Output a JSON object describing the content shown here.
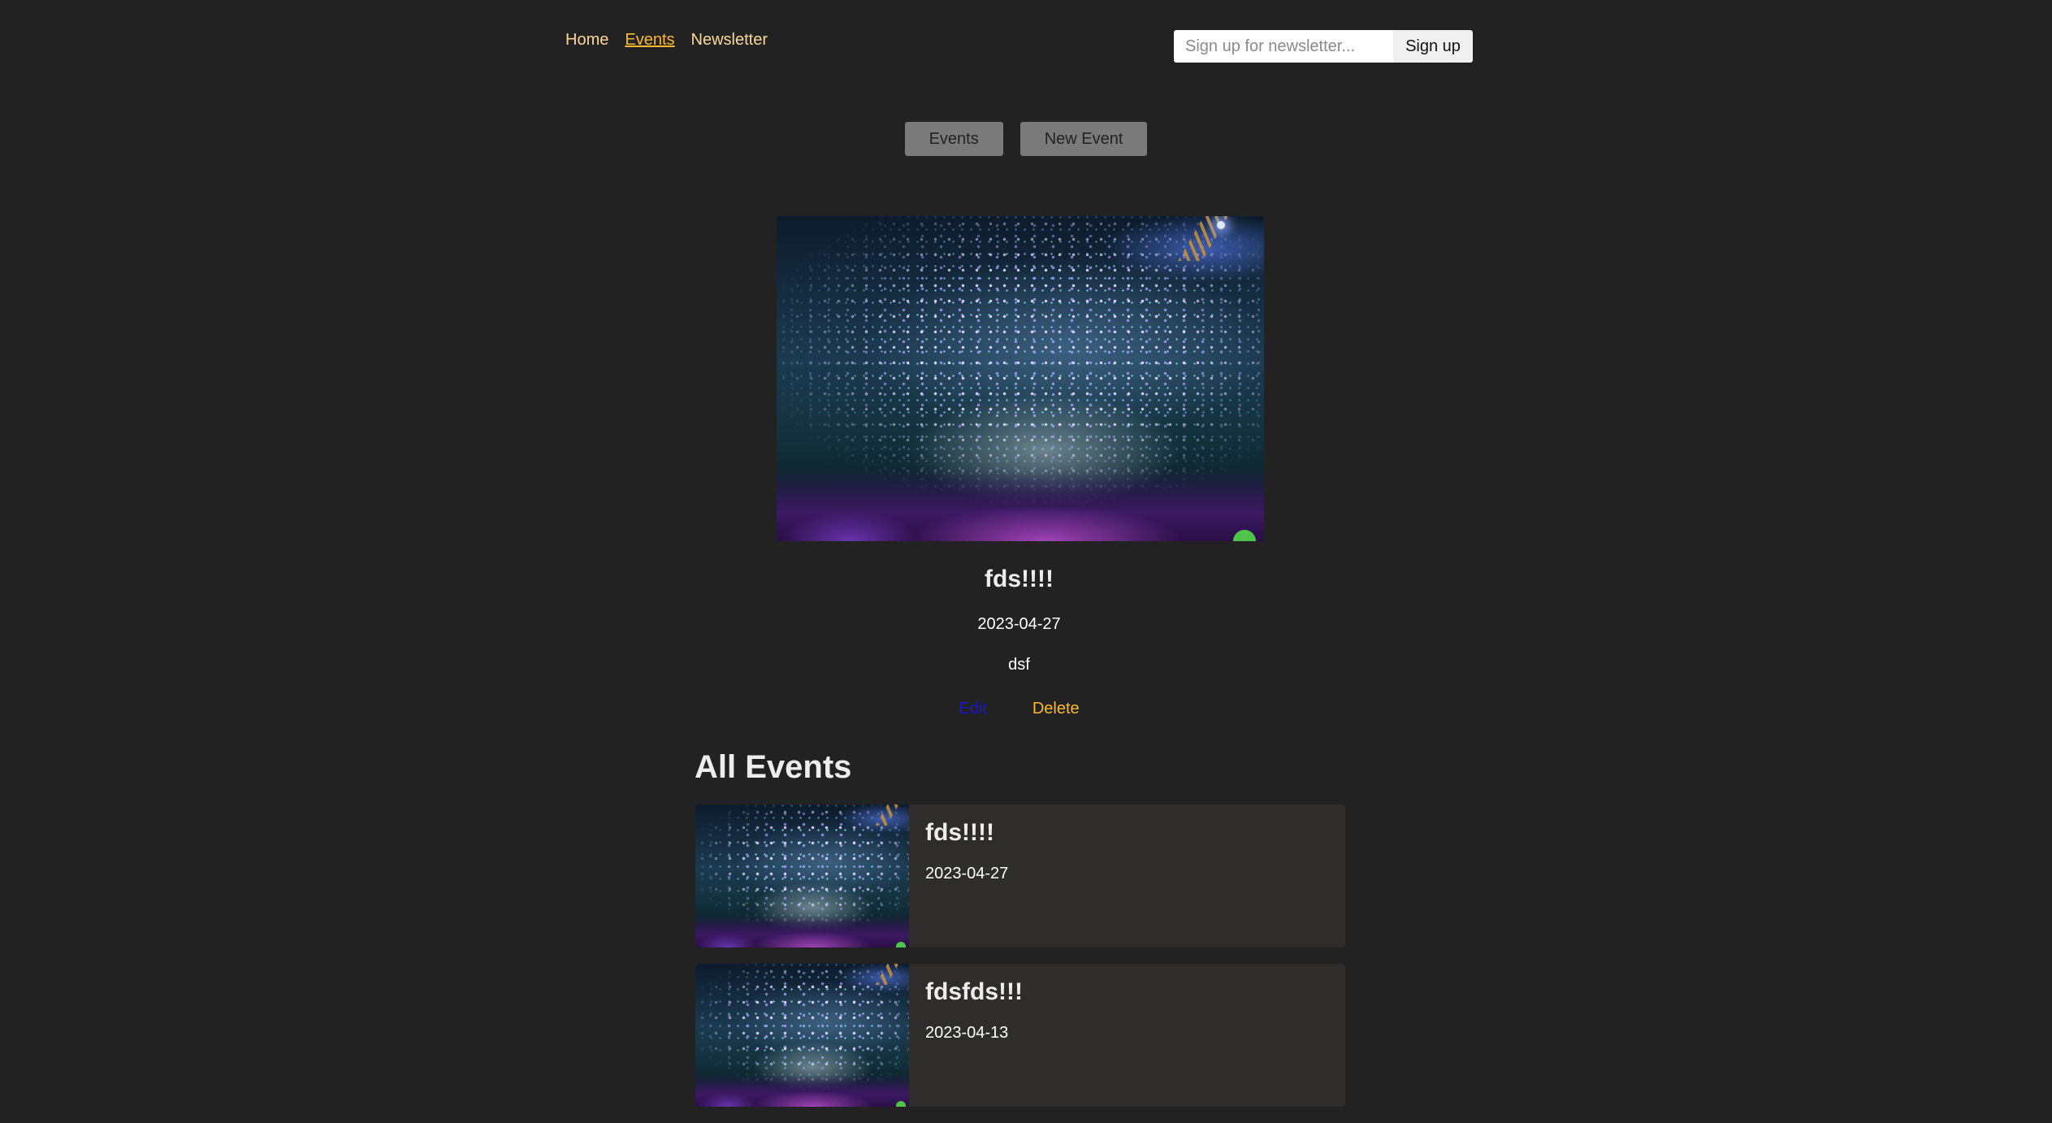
{
  "nav": {
    "links": [
      {
        "label": "Home",
        "active": false
      },
      {
        "label": "Events",
        "active": true
      },
      {
        "label": "Newsletter",
        "active": false
      }
    ]
  },
  "newsletter": {
    "placeholder": "Sign up for newsletter...",
    "value": "",
    "button_label": "Sign up"
  },
  "subnav": {
    "events_label": "Events",
    "new_event_label": "New Event"
  },
  "event_detail": {
    "image_icon": "concert-image",
    "title": "fds!!!!",
    "date": "2023-04-27",
    "description": "dsf",
    "edit_label": "Edit",
    "delete_label": "Delete"
  },
  "all_events": {
    "heading": "All Events",
    "items": [
      {
        "title": "fds!!!!",
        "date": "2023-04-27"
      },
      {
        "title": "fdsfds!!!",
        "date": "2023-04-13"
      }
    ]
  },
  "colors": {
    "background": "#222222",
    "nav_link": "#fcd79a",
    "nav_active": "#fcb92f",
    "edit_link": "#1c17c4",
    "delete_link": "#fcb92f",
    "card_background": "#2f2d2b"
  }
}
